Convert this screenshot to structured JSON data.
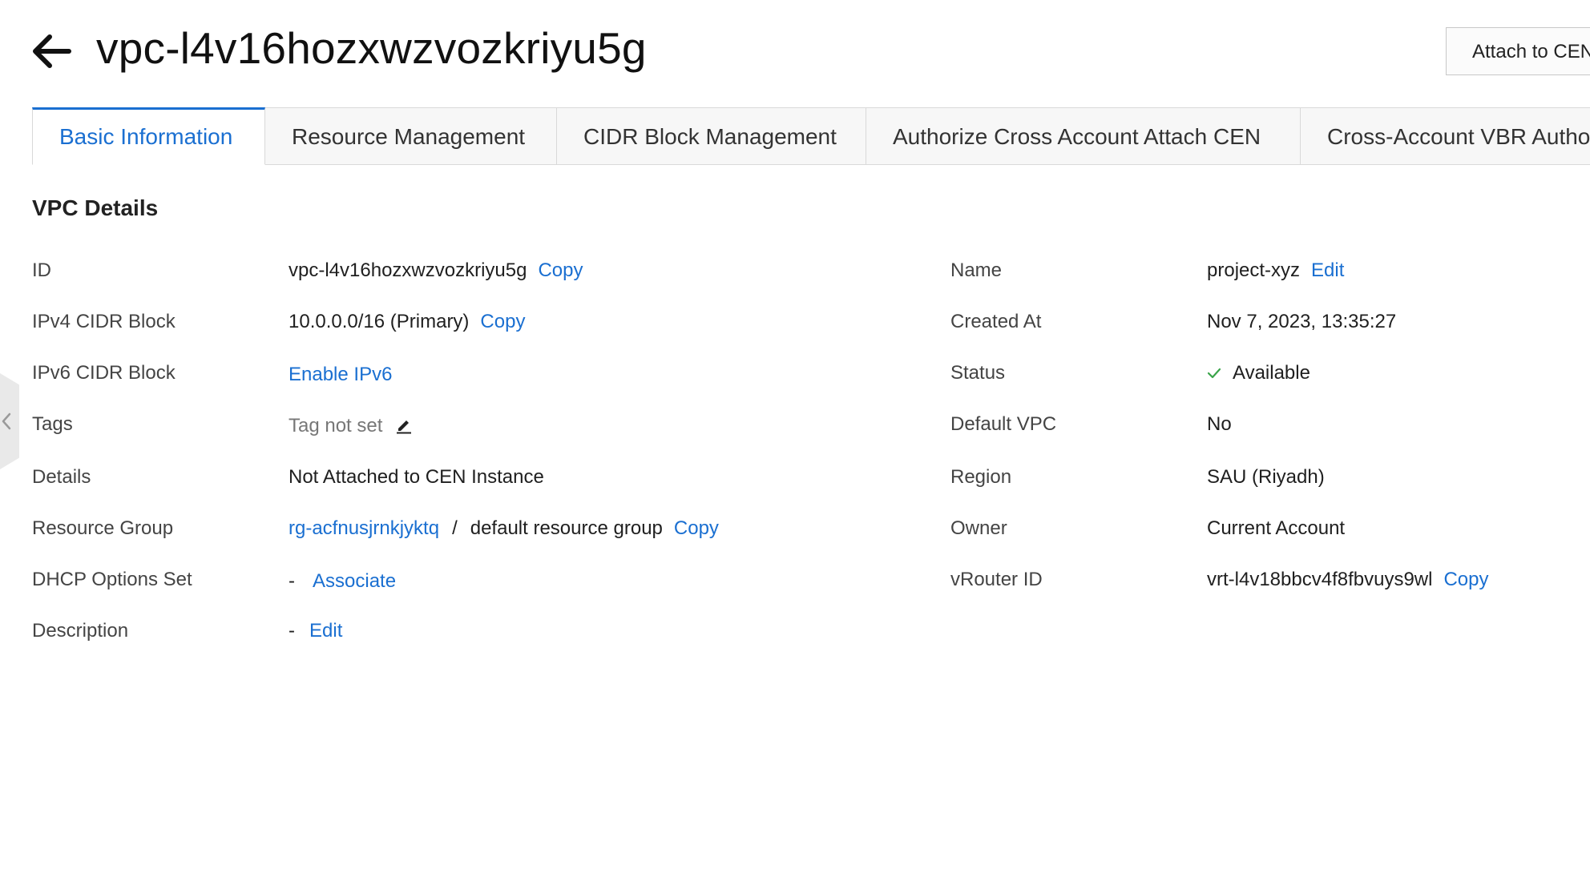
{
  "header": {
    "title": "vpc-l4v16hozxwzvozkriyu5g",
    "back_icon": "arrow-left-icon",
    "attach_button": "Attach to CEN"
  },
  "tabs": [
    {
      "label": "Basic Information",
      "active": true
    },
    {
      "label": "Resource Management",
      "active": false
    },
    {
      "label": "CIDR Block Management",
      "active": false
    },
    {
      "label": "Authorize Cross Account Attach CEN",
      "active": false
    },
    {
      "label": "Cross-Account VBR Authorization",
      "active": false
    }
  ],
  "section": {
    "title": "VPC Details"
  },
  "left": {
    "id": {
      "label": "ID",
      "value": "vpc-l4v16hozxwzvozkriyu5g",
      "action": "Copy"
    },
    "ipv4": {
      "label": "IPv4 CIDR Block",
      "value": "10.0.0.0/16 (Primary)",
      "action": "Copy"
    },
    "ipv6": {
      "label": "IPv6 CIDR Block",
      "action": "Enable IPv6"
    },
    "tags": {
      "label": "Tags",
      "value": "Tag not set",
      "icon": "edit-pencil-icon"
    },
    "details": {
      "label": "Details",
      "value": "Not Attached to CEN Instance"
    },
    "resource_group": {
      "label": "Resource Group",
      "link": "rg-acfnusjrnkjyktq",
      "separator": "/",
      "value": "default resource group",
      "action": "Copy"
    },
    "dhcp": {
      "label": "DHCP Options Set",
      "value": "-",
      "action": "Associate"
    },
    "description": {
      "label": "Description",
      "value": "-",
      "action": "Edit"
    }
  },
  "right": {
    "name": {
      "label": "Name",
      "value": "project-xyz",
      "action": "Edit"
    },
    "created": {
      "label": "Created At",
      "value": "Nov 7, 2023, 13:35:27"
    },
    "status": {
      "label": "Status",
      "value": "Available",
      "icon": "check-icon"
    },
    "default_vpc": {
      "label": "Default VPC",
      "value": "No"
    },
    "region": {
      "label": "Region",
      "value": "SAU (Riyadh)"
    },
    "owner": {
      "label": "Owner",
      "value": "Current Account"
    },
    "vrouter": {
      "label": "vRouter ID",
      "value": "vrt-l4v18bbcv4f8fbvuys9wl",
      "action": "Copy"
    }
  },
  "colors": {
    "accent": "#1a6fd1",
    "success": "#3aa44a"
  }
}
